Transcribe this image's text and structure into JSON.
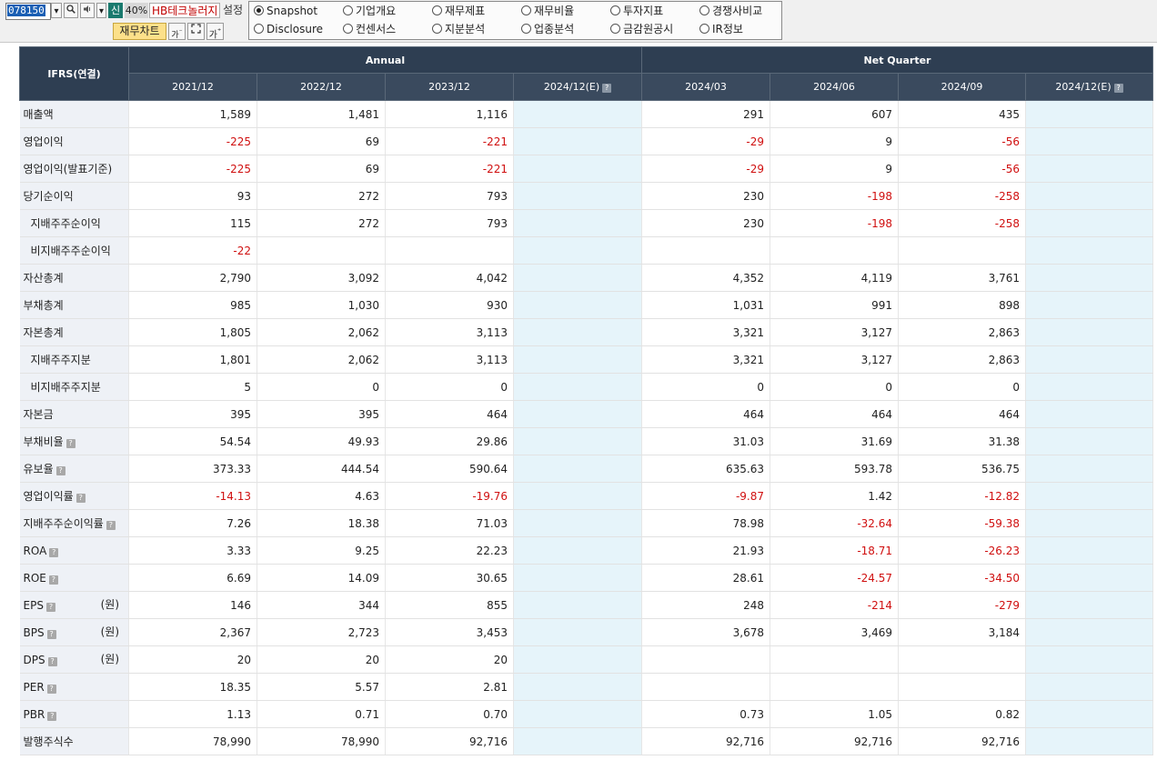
{
  "toolbar": {
    "code": "078150",
    "sin_label": "신",
    "zoom": "40%",
    "company": "HB테크놀러지",
    "setting_label": "설정",
    "chart_button": "재무차트",
    "font_btn1": "가",
    "font_btn2": "가"
  },
  "menu": [
    {
      "label": "Snapshot",
      "selected": true
    },
    {
      "label": "기업개요",
      "selected": false
    },
    {
      "label": "재무제표",
      "selected": false
    },
    {
      "label": "재무비율",
      "selected": false
    },
    {
      "label": "투자지표",
      "selected": false
    },
    {
      "label": "경쟁사비교",
      "selected": false
    },
    {
      "label": "Disclosure",
      "selected": false
    },
    {
      "label": "컨센서스",
      "selected": false
    },
    {
      "label": "지분분석",
      "selected": false
    },
    {
      "label": "업종분석",
      "selected": false
    },
    {
      "label": "금감원공시",
      "selected": false
    },
    {
      "label": "IR정보",
      "selected": false
    }
  ],
  "table": {
    "corner": "IFRS(연결)",
    "group_annual": "Annual",
    "group_quarter": "Net Quarter",
    "columns": [
      "2021/12",
      "2022/12",
      "2023/12",
      "2024/12(E)",
      "2024/03",
      "2024/06",
      "2024/09",
      "2024/12(E)"
    ],
    "rows": [
      {
        "label": "매출액",
        "values": [
          "1,589",
          "1,481",
          "1,116",
          "",
          "291",
          "607",
          "435",
          ""
        ]
      },
      {
        "label": "영업이익",
        "values": [
          "-225",
          "69",
          "-221",
          "",
          "-29",
          "9",
          "-56",
          ""
        ]
      },
      {
        "label": "영업이익(발표기준)",
        "values": [
          "-225",
          "69",
          "-221",
          "",
          "-29",
          "9",
          "-56",
          ""
        ]
      },
      {
        "label": "당기순이익",
        "values": [
          "93",
          "272",
          "793",
          "",
          "230",
          "-198",
          "-258",
          ""
        ]
      },
      {
        "label": "지배주주순이익",
        "indent": true,
        "values": [
          "115",
          "272",
          "793",
          "",
          "230",
          "-198",
          "-258",
          ""
        ]
      },
      {
        "label": "비지배주주순이익",
        "indent": true,
        "values": [
          "-22",
          "",
          "",
          "",
          "",
          "",
          "",
          ""
        ]
      },
      {
        "label": "자산총계",
        "values": [
          "2,790",
          "3,092",
          "4,042",
          "",
          "4,352",
          "4,119",
          "3,761",
          ""
        ]
      },
      {
        "label": "부채총계",
        "values": [
          "985",
          "1,030",
          "930",
          "",
          "1,031",
          "991",
          "898",
          ""
        ]
      },
      {
        "label": "자본총계",
        "values": [
          "1,805",
          "2,062",
          "3,113",
          "",
          "3,321",
          "3,127",
          "2,863",
          ""
        ]
      },
      {
        "label": "지배주주지분",
        "indent": true,
        "values": [
          "1,801",
          "2,062",
          "3,113",
          "",
          "3,321",
          "3,127",
          "2,863",
          ""
        ]
      },
      {
        "label": "비지배주주지분",
        "indent": true,
        "values": [
          "5",
          "0",
          "0",
          "",
          "0",
          "0",
          "0",
          ""
        ]
      },
      {
        "label": "자본금",
        "values": [
          "395",
          "395",
          "464",
          "",
          "464",
          "464",
          "464",
          ""
        ]
      },
      {
        "label": "부채비율",
        "help": true,
        "values": [
          "54.54",
          "49.93",
          "29.86",
          "",
          "31.03",
          "31.69",
          "31.38",
          ""
        ]
      },
      {
        "label": "유보율",
        "help": true,
        "values": [
          "373.33",
          "444.54",
          "590.64",
          "",
          "635.63",
          "593.78",
          "536.75",
          ""
        ]
      },
      {
        "label": "영업이익률",
        "help": true,
        "values": [
          "-14.13",
          "4.63",
          "-19.76",
          "",
          "-9.87",
          "1.42",
          "-12.82",
          ""
        ]
      },
      {
        "label": "지배주주순이익률",
        "help": true,
        "values": [
          "7.26",
          "18.38",
          "71.03",
          "",
          "78.98",
          "-32.64",
          "-59.38",
          ""
        ]
      },
      {
        "label": "ROA",
        "help": true,
        "values": [
          "3.33",
          "9.25",
          "22.23",
          "",
          "21.93",
          "-18.71",
          "-26.23",
          ""
        ]
      },
      {
        "label": "ROE",
        "help": true,
        "values": [
          "6.69",
          "14.09",
          "30.65",
          "",
          "28.61",
          "-24.57",
          "-34.50",
          ""
        ]
      },
      {
        "label": "EPS",
        "help": true,
        "unit": "(원)",
        "values": [
          "146",
          "344",
          "855",
          "",
          "248",
          "-214",
          "-279",
          ""
        ]
      },
      {
        "label": "BPS",
        "help": true,
        "unit": "(원)",
        "values": [
          "2,367",
          "2,723",
          "3,453",
          "",
          "3,678",
          "3,469",
          "3,184",
          ""
        ]
      },
      {
        "label": "DPS",
        "help": true,
        "unit": "(원)",
        "values": [
          "20",
          "20",
          "20",
          "",
          "",
          "",
          "",
          ""
        ]
      },
      {
        "label": "PER",
        "help": true,
        "values": [
          "18.35",
          "5.57",
          "2.81",
          "",
          "",
          "",
          "",
          ""
        ]
      },
      {
        "label": "PBR",
        "help": true,
        "values": [
          "1.13",
          "0.71",
          "0.70",
          "",
          "0.73",
          "1.05",
          "0.82",
          ""
        ]
      },
      {
        "label": "발행주식수",
        "values": [
          "78,990",
          "78,990",
          "92,716",
          "",
          "92,716",
          "92,716",
          "92,716",
          ""
        ]
      }
    ]
  }
}
